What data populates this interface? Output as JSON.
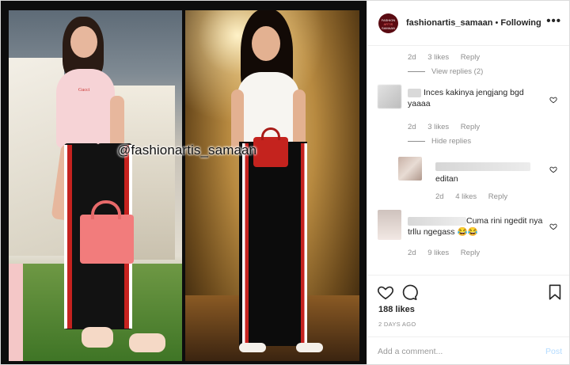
{
  "post": {
    "caption_overlay": "@fashionartis_samaan"
  },
  "header": {
    "username": "fashionartis_samaan",
    "separator": "•",
    "follow_state": "Following",
    "more_label": "•••",
    "avatar_lines": [
      "FASHION",
      "ARTIS",
      "SAMAAN"
    ]
  },
  "comments": {
    "c1": {
      "time": "2d",
      "likes": "3 likes",
      "reply": "Reply",
      "toggle": "View replies (2)"
    },
    "c2": {
      "text": "Inces kakinya jengjang bgd yaaaa",
      "time": "2d",
      "likes": "3 likes",
      "reply": "Reply",
      "toggle": "Hide replies"
    },
    "c3": {
      "text": "editan",
      "time": "2d",
      "likes": "4 likes",
      "reply": "Reply"
    },
    "c4": {
      "text": "Cuma rini ngedit nya trllu ngegass 😂😂",
      "time": "2d",
      "likes": "9 likes",
      "reply": "Reply"
    }
  },
  "actions": {
    "likes": "188 likes",
    "date": "2 DAYS AGO",
    "add_comment_placeholder": "Add a comment...",
    "post_label": "Post"
  },
  "colors": {
    "accent_link": "#b3dbff",
    "muted": "#8e8e8e",
    "text": "#262626",
    "bag_pink": "#f27c7c",
    "bag_red": "#c4231e"
  },
  "icons": [
    "heart-icon",
    "comment-icon",
    "bookmark-icon",
    "more-icon"
  ]
}
